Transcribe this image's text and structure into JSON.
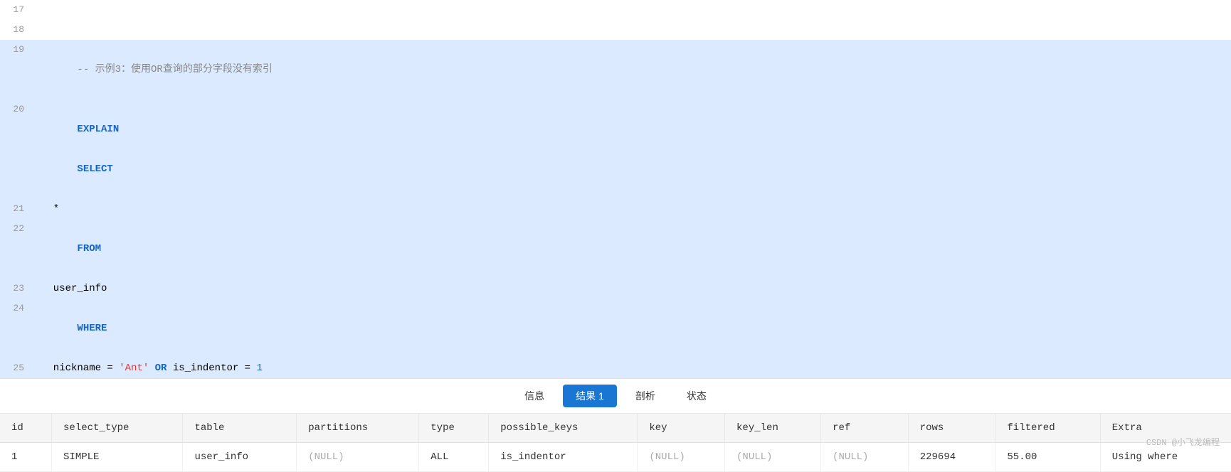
{
  "code": {
    "lines": [
      {
        "num": 17,
        "text": "",
        "highlight": false
      },
      {
        "num": 18,
        "text": "",
        "highlight": false
      },
      {
        "num": 19,
        "text": "-- 示例3：使用OR查询的部分字段没有索引",
        "highlight": true,
        "type": "comment"
      },
      {
        "num": 20,
        "text": "EXPLAIN SELECT",
        "highlight": true,
        "type": "explain_select"
      },
      {
        "num": 21,
        "text": "  *",
        "highlight": true,
        "type": "plain"
      },
      {
        "num": 22,
        "text": "FROM",
        "highlight": true,
        "type": "from"
      },
      {
        "num": 23,
        "text": "  user_info",
        "highlight": true,
        "type": "plain"
      },
      {
        "num": 24,
        "text": "WHERE",
        "highlight": true,
        "type": "where"
      },
      {
        "num": 25,
        "text": "  nickname = 'Ant' OR is_indentor = 1",
        "highlight": true,
        "type": "where_clause"
      }
    ]
  },
  "toolbar": {
    "buttons": [
      {
        "id": "info",
        "label": "信息",
        "active": false
      },
      {
        "id": "result1",
        "label": "结果 1",
        "active": true
      },
      {
        "id": "analyze",
        "label": "剖析",
        "active": false
      },
      {
        "id": "status",
        "label": "状态",
        "active": false
      }
    ]
  },
  "table": {
    "columns": [
      "id",
      "select_type",
      "table",
      "partitions",
      "type",
      "possible_keys",
      "key",
      "key_len",
      "ref",
      "rows",
      "filtered",
      "Extra"
    ],
    "rows": [
      {
        "id": "1",
        "select_type": "SIMPLE",
        "table": "user_info",
        "partitions": "(NULL)",
        "type": "ALL",
        "possible_keys": "is_indentor",
        "key": "(NULL)",
        "key_len": "(NULL)",
        "ref": "(NULL)",
        "rows": "229694",
        "filtered": "55.00",
        "extra": "Using where"
      }
    ]
  },
  "footer": {
    "watermark": "CSDN @小飞龙编程"
  }
}
